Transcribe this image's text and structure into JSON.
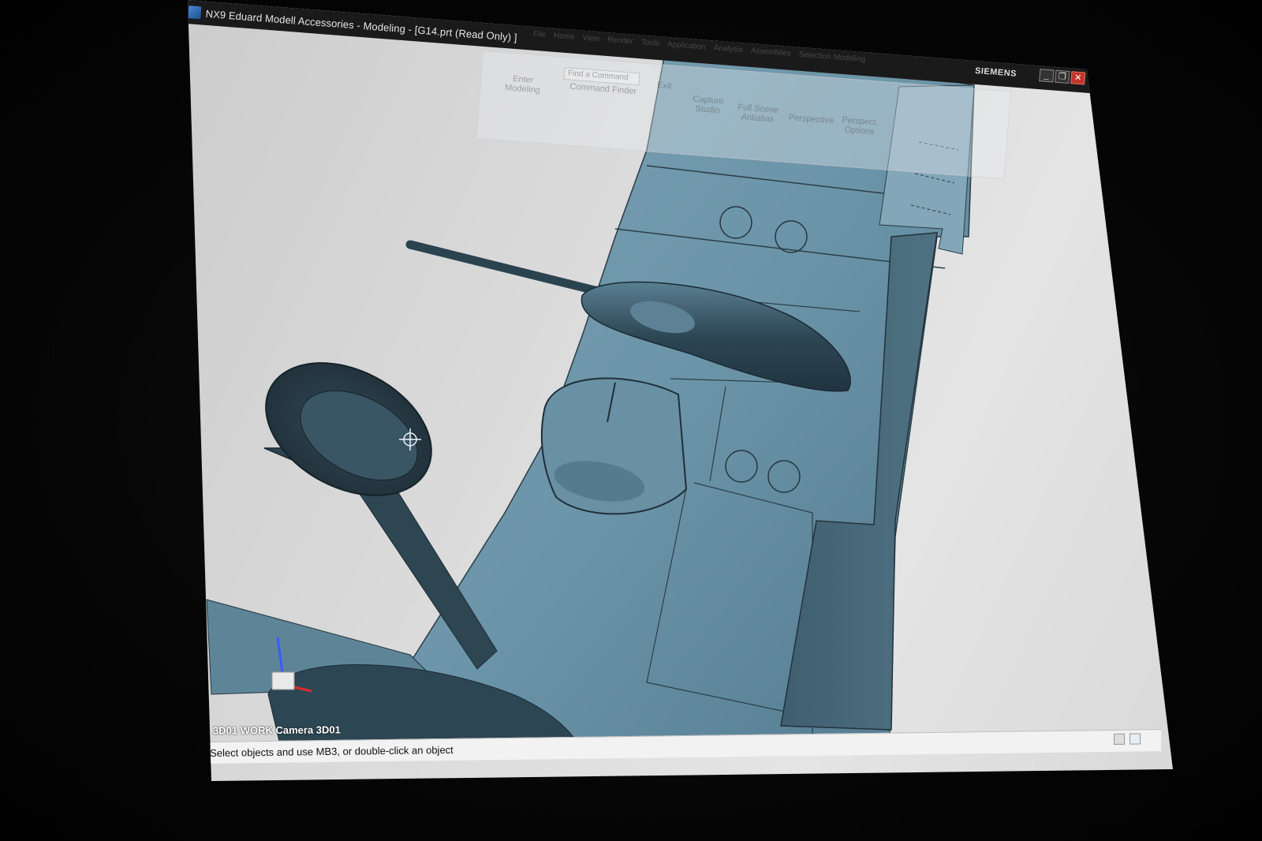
{
  "window": {
    "title": "NX9 Eduard Modell Accessories - Modeling - [G14.prt (Read Only) ]",
    "brand": "SIEMENS",
    "controls": {
      "minimize": "_",
      "restore": "❐",
      "close": "✕"
    }
  },
  "menu": [
    "File",
    "Home",
    "View",
    "Render",
    "Tools",
    "Application",
    "Analysis",
    "Assemblies",
    "Selection Modeling"
  ],
  "ribbon": {
    "search_placeholder": "Find a Command",
    "tools": {
      "enter_modeling": "Enter Modeling",
      "command_finder": "Command Finder",
      "exit": "Exit",
      "capture_studio": "Capture Studio",
      "full_scene": "Full Scene Antialias",
      "perspective": "Perspective",
      "perspective_options": "Perspect. Options"
    }
  },
  "viewport": {
    "view_label": "3D01 WORK Camera 3D01"
  },
  "status": {
    "message": "Select objects and use MB3, or double-click an object"
  }
}
